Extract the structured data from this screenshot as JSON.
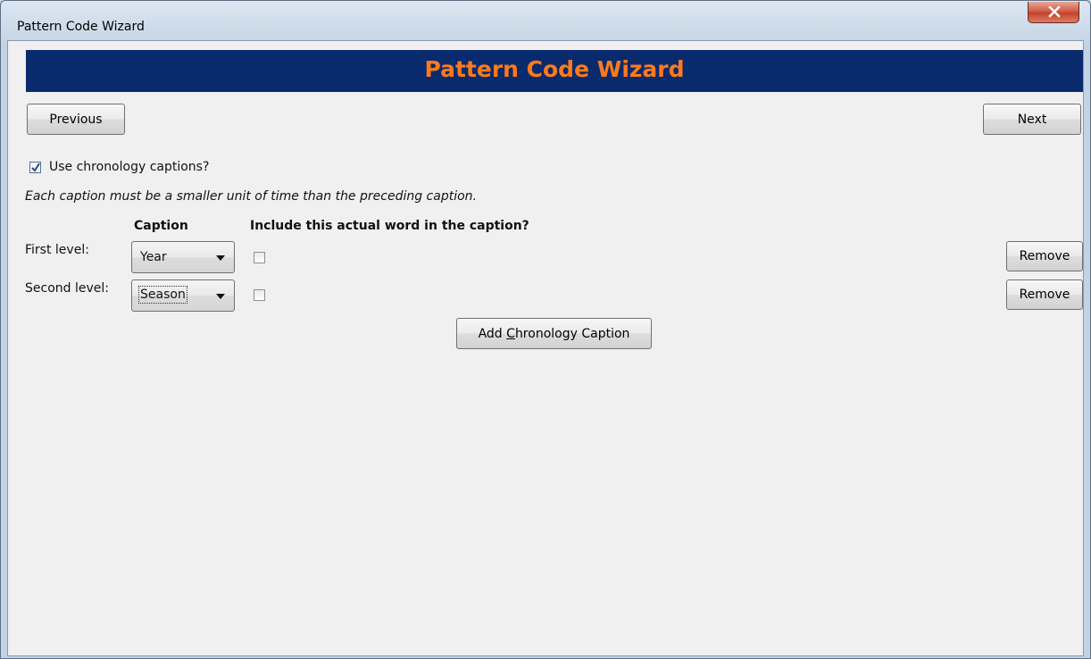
{
  "window": {
    "title": "Pattern Code Wizard",
    "close_icon": "close-x-icon"
  },
  "banner": {
    "title": "Pattern Code Wizard",
    "bg_color": "#0a2a6e",
    "text_color": "#ff7a1a"
  },
  "nav": {
    "previous_label": "Previous",
    "next_label": "Next"
  },
  "chronology": {
    "use_label": "Use chronology captions?",
    "use_checked": true,
    "hint": "Each caption must be a smaller unit of time than the preceding caption.",
    "col_caption": "Caption",
    "col_include": "Include this actual word in the caption?",
    "rows": [
      {
        "label": "First level:",
        "value": "Year",
        "include_checked": false,
        "remove_label": "Remove"
      },
      {
        "label": "Second level:",
        "value": "Season",
        "include_checked": false,
        "remove_label": "Remove"
      }
    ],
    "add_label_pre": "Add ",
    "add_label_mnemonic": "C",
    "add_label_post": "hronology Caption"
  }
}
